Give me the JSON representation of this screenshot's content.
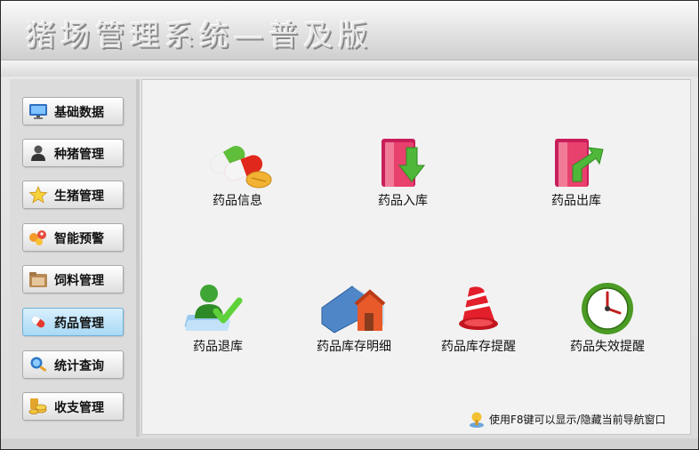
{
  "app": {
    "title": "猪场管理系统—普及版"
  },
  "sidebar": {
    "items": [
      {
        "label": "基础数据",
        "icon": "monitor-icon"
      },
      {
        "label": "种猪管理",
        "icon": "person-icon"
      },
      {
        "label": "生猪管理",
        "icon": "star-icon"
      },
      {
        "label": "智能预警",
        "icon": "alert-people-icon"
      },
      {
        "label": "饲料管理",
        "icon": "folder-icon"
      },
      {
        "label": "药品管理",
        "icon": "pills-icon",
        "active": true
      },
      {
        "label": "统计查询",
        "icon": "magnifier-icon"
      },
      {
        "label": "收支管理",
        "icon": "coins-icon"
      }
    ]
  },
  "main": {
    "tiles": [
      {
        "label": "药品信息",
        "icon": "pills-icon"
      },
      {
        "label": "药品入库",
        "icon": "folder-in-icon"
      },
      {
        "label": "药品出库",
        "icon": "folder-out-icon"
      },
      {
        "label": "药品退库",
        "icon": "user-check-icon"
      },
      {
        "label": "药品库存明细",
        "icon": "house-icon"
      },
      {
        "label": "药品库存提醒",
        "icon": "bell-icon"
      },
      {
        "label": "药品失效提醒",
        "icon": "clock-icon"
      }
    ],
    "hint": "使用F8键可以显示/隐藏当前导航窗口"
  }
}
